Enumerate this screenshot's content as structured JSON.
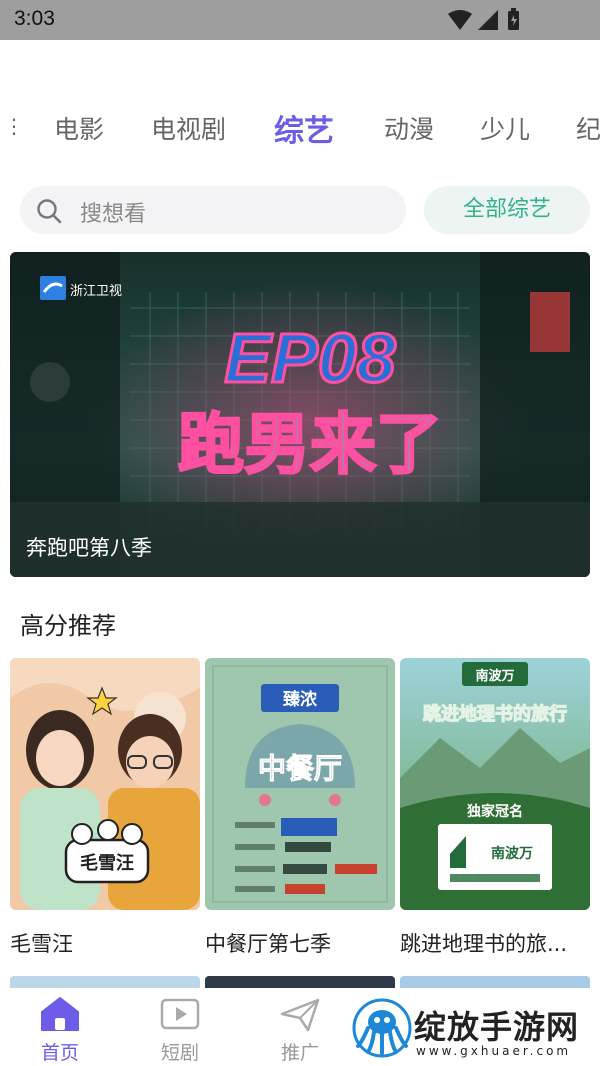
{
  "status_bar": {
    "time": "3:03"
  },
  "tabs": {
    "dots": "⋮",
    "items": [
      {
        "label": "电影"
      },
      {
        "label": "电视剧"
      },
      {
        "label": "综艺",
        "active": true
      },
      {
        "label": "动漫"
      },
      {
        "label": "少儿"
      },
      {
        "label": "纪"
      }
    ]
  },
  "search": {
    "placeholder": "搜想看",
    "all_label": "全部综艺"
  },
  "banner": {
    "caption": "奔跑吧第八季",
    "logo_text": "浙江卫视",
    "headline_1": "EP08",
    "headline_2": "跑男来了"
  },
  "section": {
    "title": "高分推荐"
  },
  "cards": [
    {
      "title": "毛雪汪",
      "poster_text": "毛雪汪"
    },
    {
      "title": "中餐厅第七季",
      "poster_text": "中餐厅",
      "sponsor": "臻浓"
    },
    {
      "title": "跳进地理书的旅...",
      "poster_text": "跳进地理书的旅行",
      "sponsor": "南波万",
      "badge": "独家冠名"
    }
  ],
  "bottom_nav": [
    {
      "label": "首页",
      "icon": "home-icon",
      "active": true
    },
    {
      "label": "短剧",
      "icon": "play-icon"
    },
    {
      "label": "推广",
      "icon": "send-icon"
    }
  ],
  "watermark": {
    "text": "绽放手游网",
    "url": "www.gxhuaer.com"
  },
  "colors": {
    "accent": "#6c5ce7",
    "teal": "#31b28e",
    "status_bg": "#9e9e9e"
  }
}
